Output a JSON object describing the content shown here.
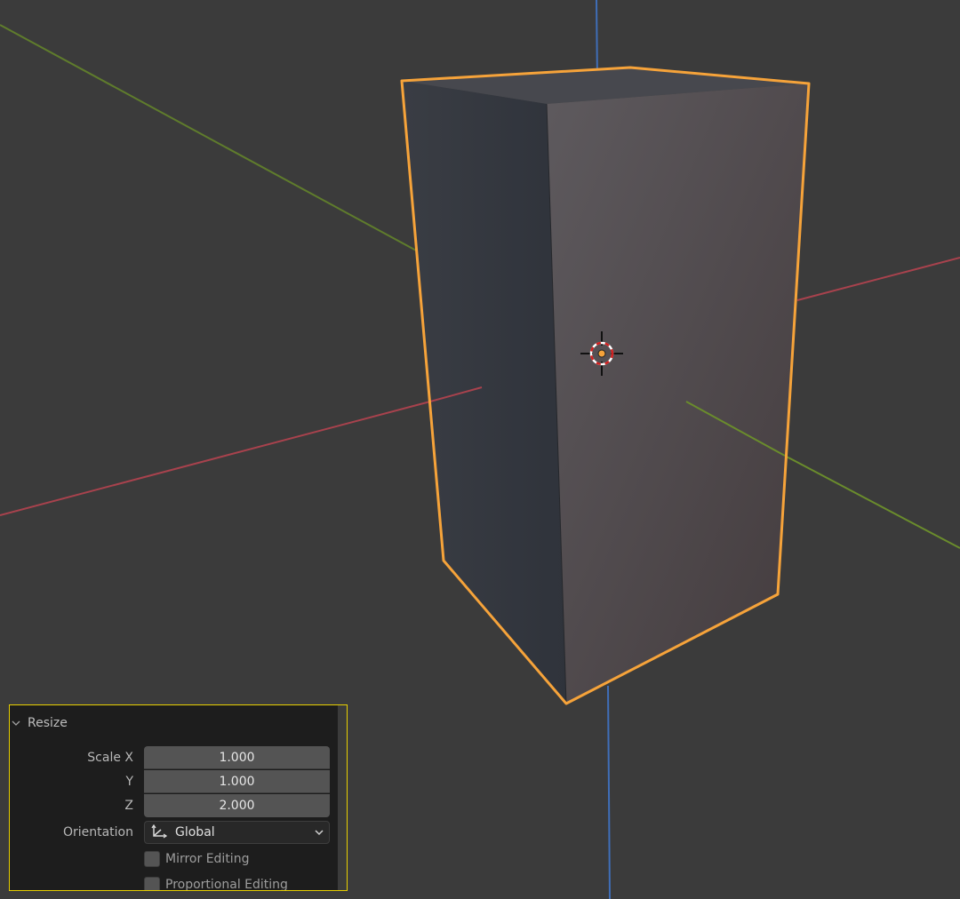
{
  "viewport": {
    "colors": {
      "background": "#3b3b3b",
      "axis_x": "#b04550",
      "axis_y": "#6a8c2c",
      "axis_z": "#3f6eb8",
      "selection_outline": "#f6a33a"
    }
  },
  "operator_panel": {
    "title": "Resize",
    "collapse_icon": "chevron-down-icon",
    "scale_label": "Scale X",
    "y_label": "Y",
    "z_label": "Z",
    "scale_x": "1.000",
    "scale_y": "1.000",
    "scale_z": "2.000",
    "orientation_label": "Orientation",
    "orientation_value": "Global",
    "orientation_icon": "transform-orientation-icon",
    "mirror_editing": "Mirror Editing",
    "proportional_editing": "Proportional Editing",
    "border_color": "#e8d000"
  }
}
